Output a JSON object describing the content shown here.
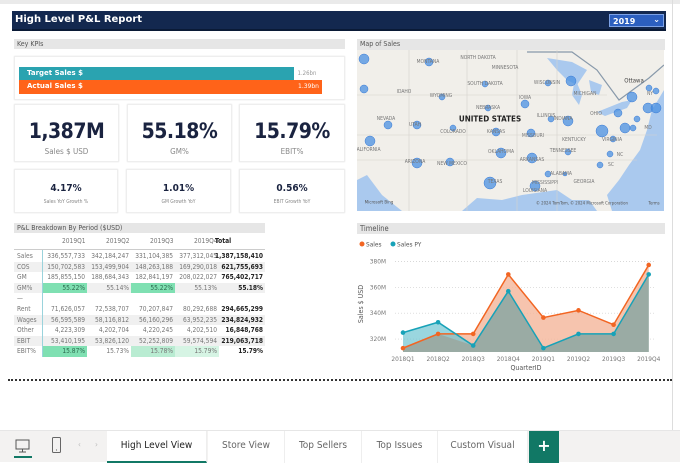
{
  "header": {
    "title": "High Level P&L Report",
    "year_filter": "2019"
  },
  "kpis": {
    "section_title": "Key KPIs",
    "target_label": "Target Sales $",
    "target_value": "1.26bn",
    "target_fraction": 0.906,
    "actual_label": "Actual Sales $",
    "actual_value": "1.39bn",
    "actual_fraction": 1.0,
    "cards": [
      {
        "value": "1,387M",
        "label": "Sales $ USD"
      },
      {
        "value": "55.18%",
        "label": "GM%"
      },
      {
        "value": "15.79%",
        "label": "EBIT%"
      }
    ],
    "small_cards": [
      {
        "value": "4.17%",
        "label": "Sales YoY Growth %"
      },
      {
        "value": "1.01%",
        "label": "GM Growth YoY"
      },
      {
        "value": "0.56%",
        "label": "EBIT Growth YoY"
      }
    ]
  },
  "colors": {
    "header": "#13284f",
    "target": "#2aa3b0",
    "actual": "#ff6319",
    "sales": "#f26522",
    "sales_py": "#17a2b8",
    "accent": "#117865",
    "bubble": "#4a90e2"
  },
  "pl": {
    "title": "P&L Breakdown By Period ($USD)",
    "columns": [
      "",
      "2019Q1",
      "2019Q2",
      "2019Q3",
      "2019Q4",
      "Total"
    ],
    "rows": [
      [
        "Sales",
        "336,557,733",
        "342,184,247",
        "331,104,385",
        "377,312,045",
        "1,387,158,410"
      ],
      [
        "COS",
        "150,702,583",
        "153,499,904",
        "148,263,188",
        "169,290,018",
        "621,755,693"
      ],
      [
        "GM",
        "185,855,150",
        "188,684,343",
        "182,841,197",
        "208,022,027",
        "765,402,717"
      ],
      [
        "GM%",
        "55.22%",
        "55.14%",
        "55.22%",
        "55.13%",
        "55.18%"
      ],
      [
        "—",
        "",
        "",
        "",
        "",
        ""
      ],
      [
        "Rent",
        "71,626,057",
        "72,538,707",
        "70,207,847",
        "80,292,688",
        "294,665,299"
      ],
      [
        "Wages",
        "56,595,589",
        "58,116,812",
        "56,160,296",
        "63,952,235",
        "234,824,932"
      ],
      [
        "Other",
        "4,223,309",
        "4,202,704",
        "4,220,245",
        "4,202,510",
        "16,848,768"
      ],
      [
        "EBIT",
        "53,410,195",
        "53,826,120",
        "52,252,809",
        "59,574,594",
        "219,063,718"
      ],
      [
        "EBIT%",
        "15.87%",
        "15.73%",
        "15.78%",
        "15.79%",
        "15.79%"
      ]
    ]
  },
  "map": {
    "title": "Map of Sales",
    "country_label": "UNITED STATES",
    "city_label": "Ottawa",
    "state_labels": [
      "NORTH DAKOTA",
      "MINNESOTA",
      "MONTANA",
      "SOUTH DAKOTA",
      "WISCONSIN",
      "MICHIGAN",
      "IDAHO",
      "WYOMING",
      "IOWA",
      "NEBRASKA",
      "ILLINOIS",
      "INDIANA",
      "OHIO",
      "NEVADA",
      "UTAH",
      "COLORADO",
      "KANSAS",
      "MISSOURI",
      "KENTUCKY",
      "VIRGINIA",
      "CALIFORNIA",
      "TENNESSEE",
      "OKLAHOMA",
      "ARKANSAS",
      "ARIZONA",
      "NEW MEXICO",
      "ALABAMA",
      "MISSISSIPPI",
      "GEORGIA",
      "TEXAS",
      "LOUISIANA",
      "NY",
      "NC",
      "SC",
      "MD"
    ],
    "brand": "Microsoft Bing",
    "copyright": "© 2024 TomTom, © 2024 Microsoft Corporation",
    "terms": "Terms"
  },
  "chart_data": {
    "type": "area",
    "title": "Timeline",
    "xlabel": "QuarterID",
    "ylabel": "Sales $ USD",
    "categories": [
      "2018Q1",
      "2018Q2",
      "2018Q3",
      "2018Q4",
      "2019Q1",
      "2019Q2",
      "2019Q3",
      "2019Q4"
    ],
    "yticks": [
      "320M",
      "340M",
      "360M",
      "380M"
    ],
    "ylim": [
      310,
      385
    ],
    "series": [
      {
        "name": "Sales",
        "values": [
          313,
          324,
          324,
          370,
          336.6,
          342.2,
          331.1,
          377.3
        ]
      },
      {
        "name": "Sales PY",
        "values": [
          325,
          333,
          315,
          357,
          313,
          324,
          324,
          370
        ]
      }
    ],
    "grid": true,
    "legend": "top-left"
  },
  "tabs": {
    "items": [
      "High Level View",
      "Store View",
      "Top Sellers",
      "Top Issues",
      "Custom Visual"
    ],
    "active": 0,
    "add": "+"
  }
}
